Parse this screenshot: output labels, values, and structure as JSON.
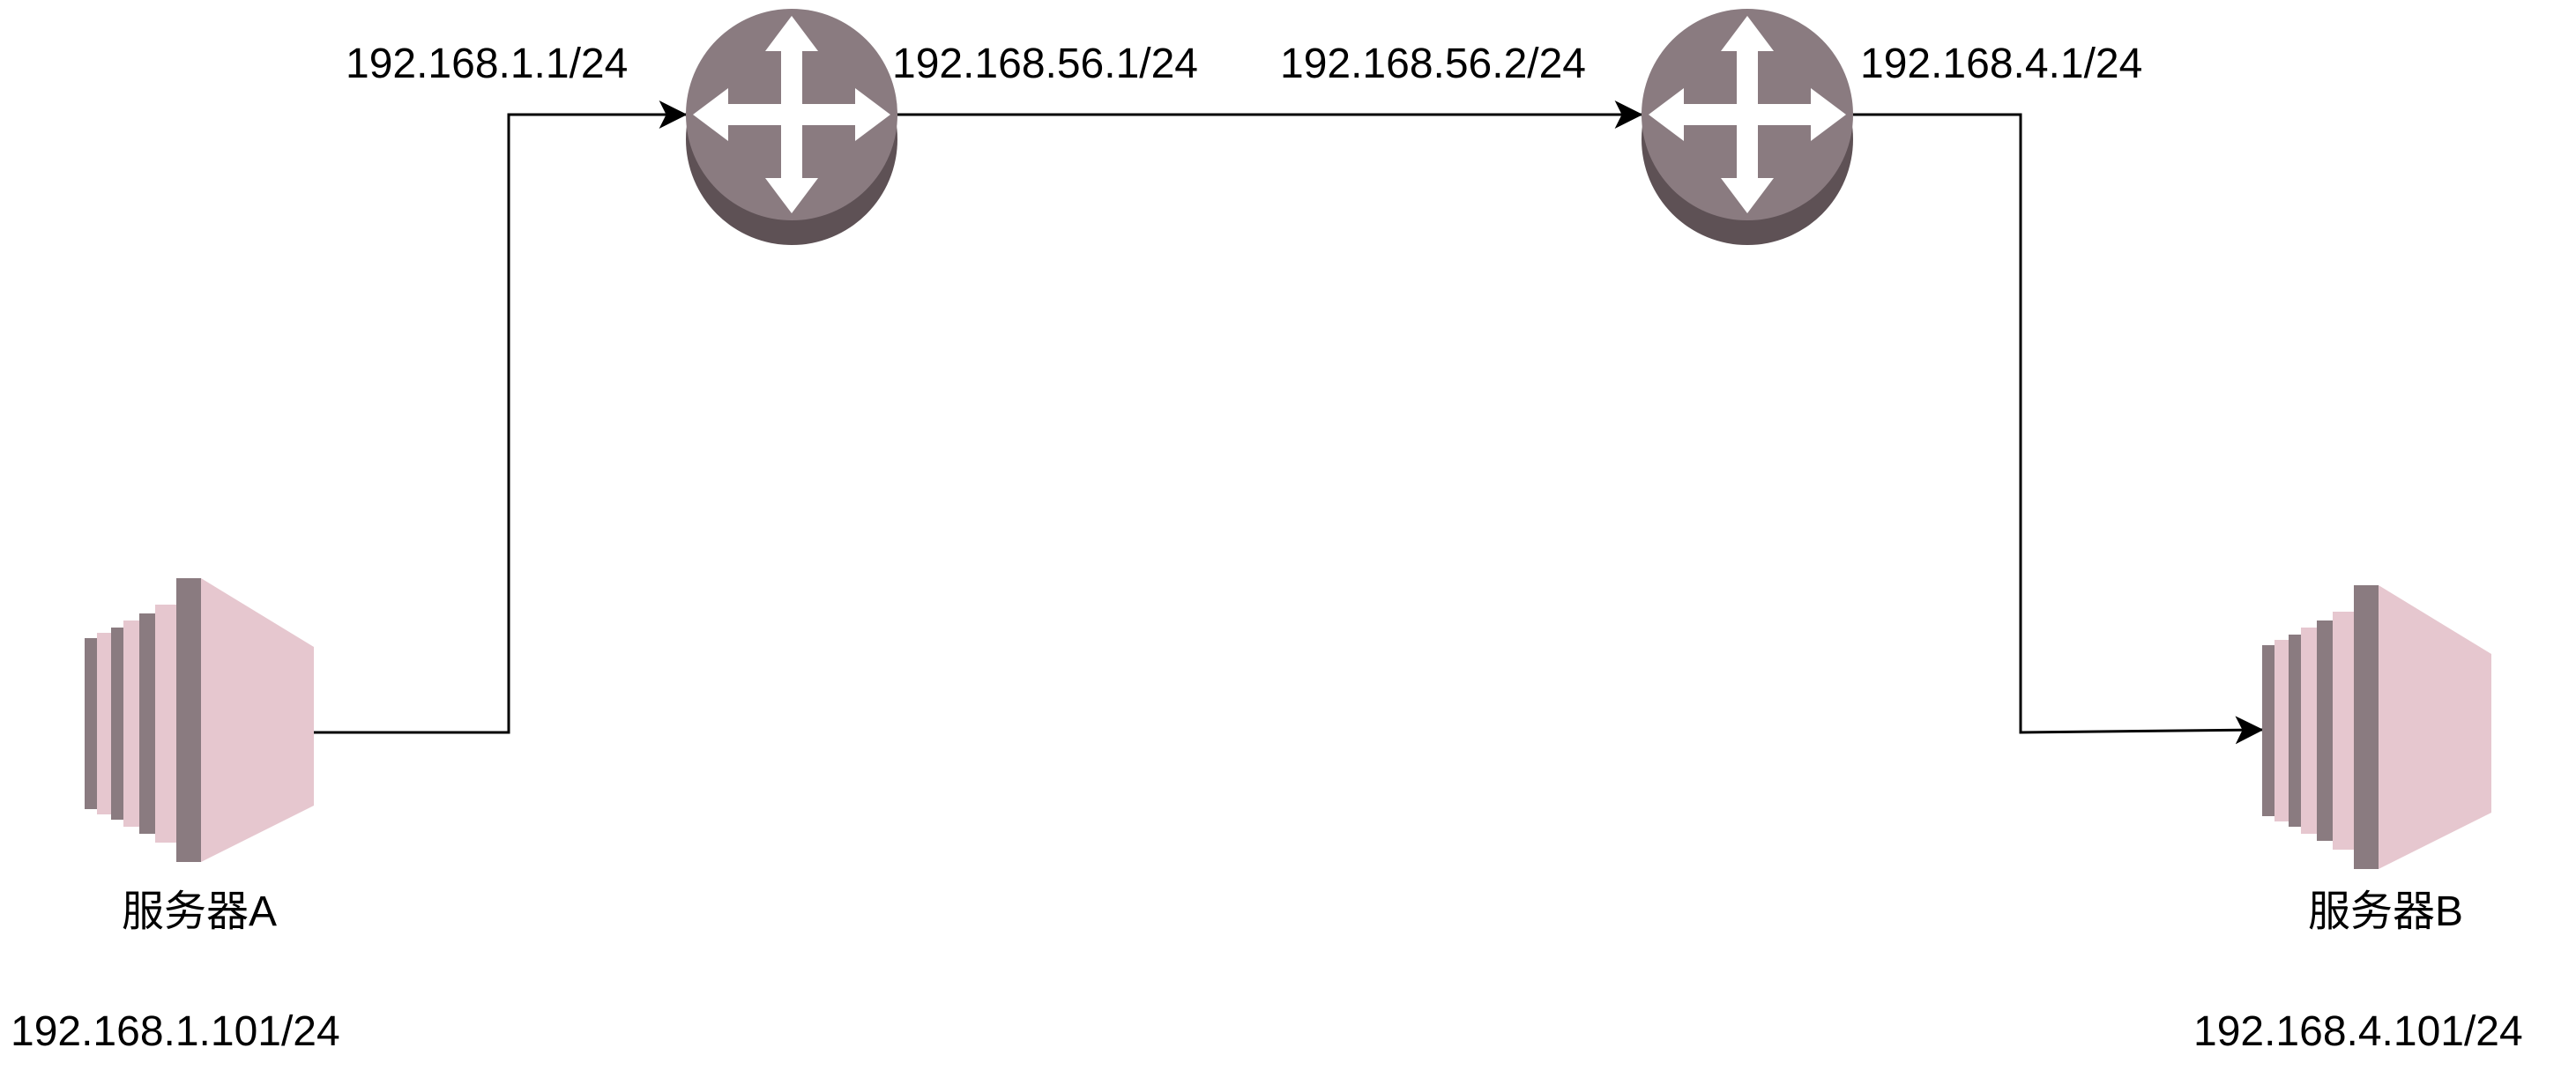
{
  "diagram": {
    "colors": {
      "router_body": "#8a7b80",
      "router_shadow": "#5e5155",
      "arrow_fill": "#ffffff",
      "server_front": "#e6c7cf",
      "server_fin": "#8a7b80",
      "server_fin_light": "#e6c7cf",
      "link": "#000000"
    },
    "routers": [
      {
        "icon": "router-icon",
        "left_interface": "192.168.1.1/24",
        "right_interface": "192.168.56.1/24"
      },
      {
        "icon": "router-icon",
        "left_interface": "192.168.56.2/24",
        "right_interface": "192.168.4.1/24"
      }
    ],
    "servers": [
      {
        "icon": "server-icon",
        "name": "服务器A",
        "ip": "192.168.1.101/24"
      },
      {
        "icon": "server-icon",
        "name": "服务器B",
        "ip": "192.168.4.101/24"
      }
    ]
  }
}
